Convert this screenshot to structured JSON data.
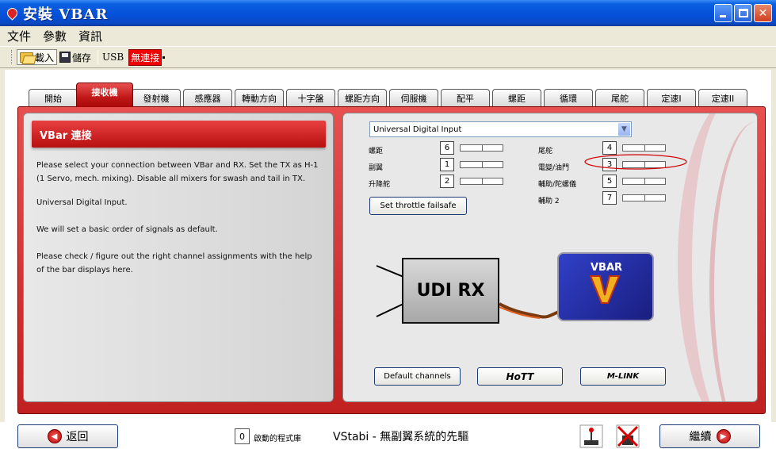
{
  "window": {
    "title": "安裝 VBAR"
  },
  "menu": {
    "items": [
      "文件",
      "參數",
      "資訊"
    ]
  },
  "toolbar": {
    "load_label": "載入",
    "save_label": "儲存",
    "usb_label": "USB",
    "connection_status": "無連接",
    "connection_color": "#f00000"
  },
  "tabs": [
    "開始",
    "接收機",
    "發射機",
    "感應器",
    "轉動方向",
    "十字盤",
    "螺距方向",
    "伺服機",
    "配平",
    "螺距",
    "循環",
    "尾舵",
    "定速I",
    "定速II"
  ],
  "active_tab": "接收機",
  "left_panel": {
    "title": "VBar 連接",
    "paragraphs": [
      "Please select your connection between VBar and RX. Set the TX as H-1 (1 Servo, mech. mixing). Disable all mixers for swash and tail in TX.",
      "Universal Digital Input.",
      "We will set a basic order of signals as default.",
      "Please check / figure out the right channel assignments with the help of the bar displays here."
    ]
  },
  "right_panel": {
    "receiver_type": "Universal Digital Input",
    "channels_left": [
      {
        "label": "螺距",
        "value": "6"
      },
      {
        "label": "副翼",
        "value": "1"
      },
      {
        "label": "升降舵",
        "value": "2"
      }
    ],
    "channels_right": [
      {
        "label": "尾舵",
        "value": "4"
      },
      {
        "label": "電變/油門",
        "value": "3"
      },
      {
        "label": "輔助/陀螺儀",
        "value": "5"
      },
      {
        "label": "輔助 2",
        "value": "7"
      }
    ],
    "throttle_failsafe_label": "Set throttle failsafe",
    "udi_rx_label": "UDI RX",
    "vbar_label": "VBAR",
    "default_channels_label": "Default channels",
    "hott_label": "HoTT",
    "mlink_label": "M-LINK"
  },
  "bottom": {
    "back_label": "返回",
    "continue_label": "繼續",
    "active_programs_count": "0",
    "active_programs_label": "啟動的程式庫",
    "slogan": "VStabi - 無副翼系統的先驅"
  }
}
